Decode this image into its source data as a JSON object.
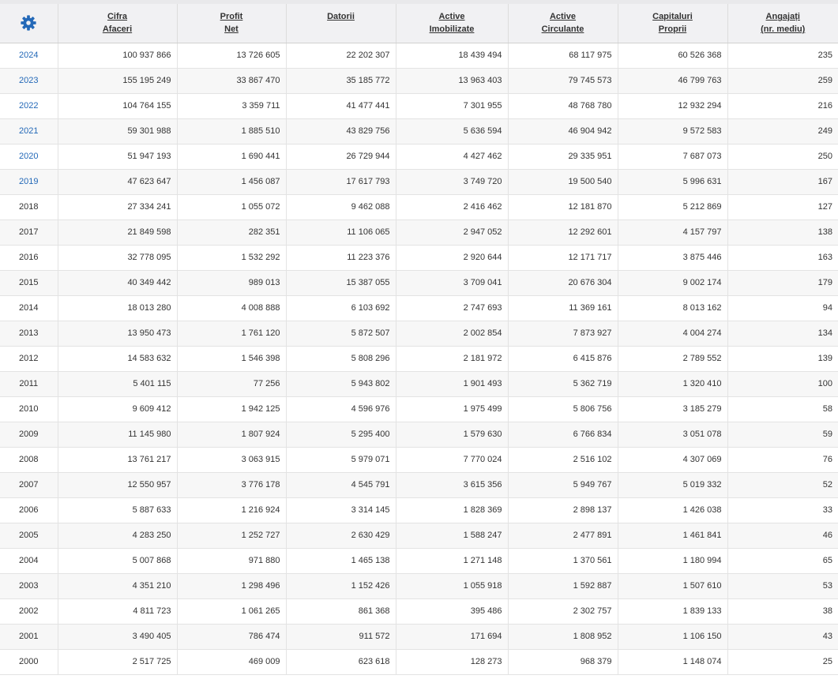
{
  "colors": {
    "accent": "#2469b8",
    "header_bg": "#f1f1f3",
    "row_alt": "#f7f7f7"
  },
  "settings_icon": "gear-icon",
  "columns": [
    {
      "line1": "Cifra",
      "line2": "Afaceri"
    },
    {
      "line1": "Profit",
      "line2": "Net"
    },
    {
      "line1": "Datorii",
      "line2": ""
    },
    {
      "line1": "Active",
      "line2": "Imobilizate"
    },
    {
      "line1": "Active",
      "line2": "Circulante"
    },
    {
      "line1": "Capitaluri",
      "line2": "Proprii"
    },
    {
      "line1": "Angajați",
      "line2": "(nr. mediu)"
    }
  ],
  "rows": [
    {
      "year": "2024",
      "link": true,
      "values": [
        "100 937 866",
        "13 726 605",
        "22 202 307",
        "18 439 494",
        "68 117 975",
        "60 526 368",
        "235"
      ]
    },
    {
      "year": "2023",
      "link": true,
      "values": [
        "155 195 249",
        "33 867 470",
        "35 185 772",
        "13 963 403",
        "79 745 573",
        "46 799 763",
        "259"
      ]
    },
    {
      "year": "2022",
      "link": true,
      "values": [
        "104 764 155",
        "3 359 711",
        "41 477 441",
        "7 301 955",
        "48 768 780",
        "12 932 294",
        "216"
      ]
    },
    {
      "year": "2021",
      "link": true,
      "values": [
        "59 301 988",
        "1 885 510",
        "43 829 756",
        "5 636 594",
        "46 904 942",
        "9 572 583",
        "249"
      ]
    },
    {
      "year": "2020",
      "link": true,
      "values": [
        "51 947 193",
        "1 690 441",
        "26 729 944",
        "4 427 462",
        "29 335 951",
        "7 687 073",
        "250"
      ]
    },
    {
      "year": "2019",
      "link": true,
      "values": [
        "47 623 647",
        "1 456 087",
        "17 617 793",
        "3 749 720",
        "19 500 540",
        "5 996 631",
        "167"
      ]
    },
    {
      "year": "2018",
      "link": false,
      "values": [
        "27 334 241",
        "1 055 072",
        "9 462 088",
        "2 416 462",
        "12 181 870",
        "5 212 869",
        "127"
      ]
    },
    {
      "year": "2017",
      "link": false,
      "values": [
        "21 849 598",
        "282 351",
        "11 106 065",
        "2 947 052",
        "12 292 601",
        "4 157 797",
        "138"
      ]
    },
    {
      "year": "2016",
      "link": false,
      "values": [
        "32 778 095",
        "1 532 292",
        "11 223 376",
        "2 920 644",
        "12 171 717",
        "3 875 446",
        "163"
      ]
    },
    {
      "year": "2015",
      "link": false,
      "values": [
        "40 349 442",
        "989 013",
        "15 387 055",
        "3 709 041",
        "20 676 304",
        "9 002 174",
        "179"
      ]
    },
    {
      "year": "2014",
      "link": false,
      "values": [
        "18 013 280",
        "4 008 888",
        "6 103 692",
        "2 747 693",
        "11 369 161",
        "8 013 162",
        "94"
      ]
    },
    {
      "year": "2013",
      "link": false,
      "values": [
        "13 950 473",
        "1 761 120",
        "5 872 507",
        "2 002 854",
        "7 873 927",
        "4 004 274",
        "134"
      ]
    },
    {
      "year": "2012",
      "link": false,
      "values": [
        "14 583 632",
        "1 546 398",
        "5 808 296",
        "2 181 972",
        "6 415 876",
        "2 789 552",
        "139"
      ]
    },
    {
      "year": "2011",
      "link": false,
      "values": [
        "5 401 115",
        "77 256",
        "5 943 802",
        "1 901 493",
        "5 362 719",
        "1 320 410",
        "100"
      ]
    },
    {
      "year": "2010",
      "link": false,
      "values": [
        "9 609 412",
        "1 942 125",
        "4 596 976",
        "1 975 499",
        "5 806 756",
        "3 185 279",
        "58"
      ]
    },
    {
      "year": "2009",
      "link": false,
      "values": [
        "11 145 980",
        "1 807 924",
        "5 295 400",
        "1 579 630",
        "6 766 834",
        "3 051 078",
        "59"
      ]
    },
    {
      "year": "2008",
      "link": false,
      "values": [
        "13 761 217",
        "3 063 915",
        "5 979 071",
        "7 770 024",
        "2 516 102",
        "4 307 069",
        "76"
      ]
    },
    {
      "year": "2007",
      "link": false,
      "values": [
        "12 550 957",
        "3 776 178",
        "4 545 791",
        "3 615 356",
        "5 949 767",
        "5 019 332",
        "52"
      ]
    },
    {
      "year": "2006",
      "link": false,
      "values": [
        "5 887 633",
        "1 216 924",
        "3 314 145",
        "1 828 369",
        "2 898 137",
        "1 426 038",
        "33"
      ]
    },
    {
      "year": "2005",
      "link": false,
      "values": [
        "4 283 250",
        "1 252 727",
        "2 630 429",
        "1 588 247",
        "2 477 891",
        "1 461 841",
        "46"
      ]
    },
    {
      "year": "2004",
      "link": false,
      "values": [
        "5 007 868",
        "971 880",
        "1 465 138",
        "1 271 148",
        "1 370 561",
        "1 180 994",
        "65"
      ]
    },
    {
      "year": "2003",
      "link": false,
      "values": [
        "4 351 210",
        "1 298 496",
        "1 152 426",
        "1 055 918",
        "1 592 887",
        "1 507 610",
        "53"
      ]
    },
    {
      "year": "2002",
      "link": false,
      "values": [
        "4 811 723",
        "1 061 265",
        "861 368",
        "395 486",
        "2 302 757",
        "1 839 133",
        "38"
      ]
    },
    {
      "year": "2001",
      "link": false,
      "values": [
        "3 490 405",
        "786 474",
        "911 572",
        "171 694",
        "1 808 952",
        "1 106 150",
        "43"
      ]
    },
    {
      "year": "2000",
      "link": false,
      "values": [
        "2 517 725",
        "469 009",
        "623 618",
        "128 273",
        "968 379",
        "1 148 074",
        "25"
      ]
    }
  ]
}
